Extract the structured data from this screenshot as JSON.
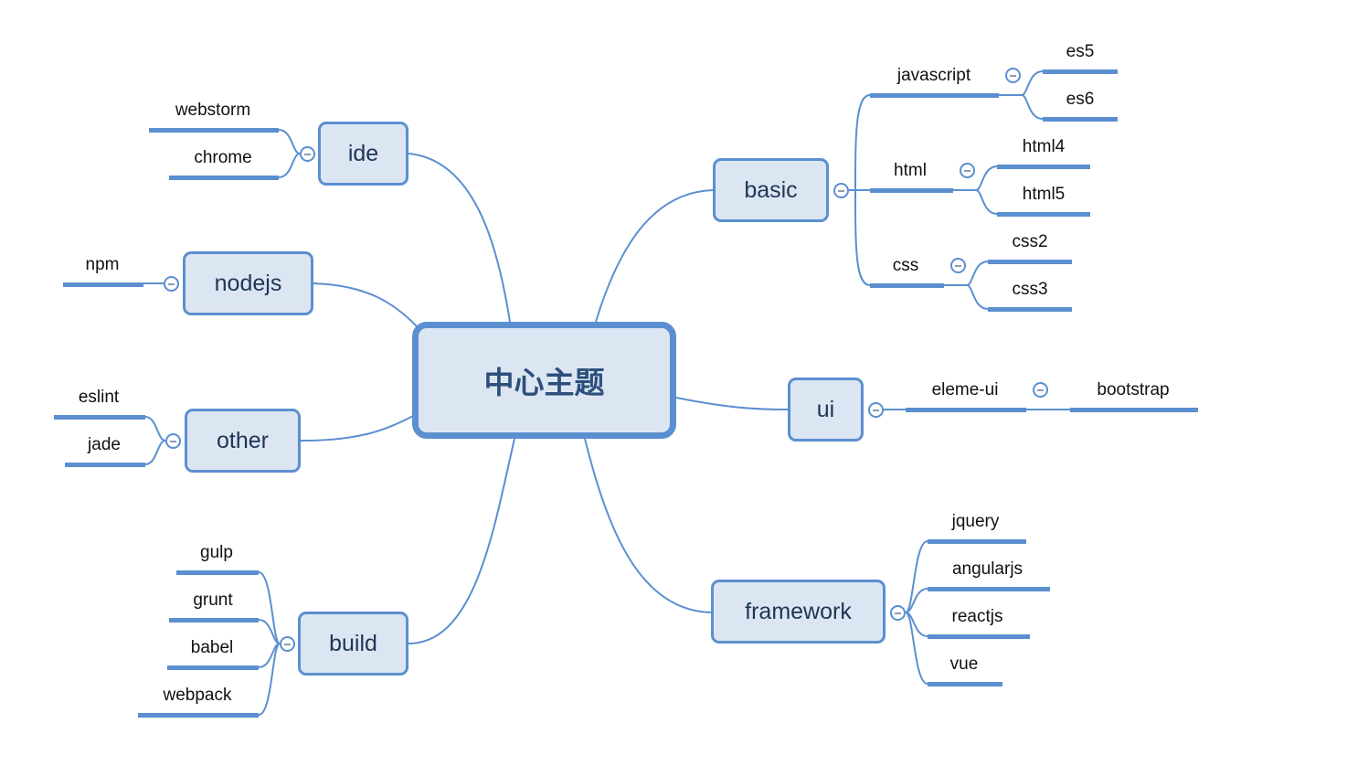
{
  "diagram": {
    "type": "mindmap",
    "colors": {
      "accent": "#5b8fd0",
      "topic_fill": "#dce6f2",
      "topic_text": "#1e3556",
      "leaf_text": "#111111"
    },
    "central": {
      "label": "中心主题"
    },
    "branches": [
      {
        "id": "basic",
        "label": "basic",
        "side": "right",
        "children": [
          {
            "label": "javascript",
            "children": [
              {
                "label": "es5"
              },
              {
                "label": "es6"
              }
            ]
          },
          {
            "label": "html",
            "children": [
              {
                "label": "html4"
              },
              {
                "label": "html5"
              }
            ]
          },
          {
            "label": "css",
            "children": [
              {
                "label": "css2"
              },
              {
                "label": "css3"
              }
            ]
          }
        ]
      },
      {
        "id": "ui",
        "label": "ui",
        "side": "right",
        "children": [
          {
            "label": "eleme-ui",
            "children": [
              {
                "label": "bootstrap"
              }
            ]
          }
        ]
      },
      {
        "id": "framework",
        "label": "framework",
        "side": "right",
        "children": [
          {
            "label": "jquery"
          },
          {
            "label": "angularjs"
          },
          {
            "label": "reactjs"
          },
          {
            "label": "vue"
          }
        ]
      },
      {
        "id": "ide",
        "label": "ide",
        "side": "left",
        "children": [
          {
            "label": "webstorm"
          },
          {
            "label": "chrome"
          }
        ]
      },
      {
        "id": "nodejs",
        "label": "nodejs",
        "side": "left",
        "children": [
          {
            "label": "npm"
          }
        ]
      },
      {
        "id": "other",
        "label": "other",
        "side": "left",
        "children": [
          {
            "label": "eslint"
          },
          {
            "label": "jade"
          }
        ]
      },
      {
        "id": "build",
        "label": "build",
        "side": "left",
        "children": [
          {
            "label": "gulp"
          },
          {
            "label": "grunt"
          },
          {
            "label": "babel"
          },
          {
            "label": "webpack"
          }
        ]
      }
    ],
    "collapse_icon": "minus-circle-icon"
  }
}
